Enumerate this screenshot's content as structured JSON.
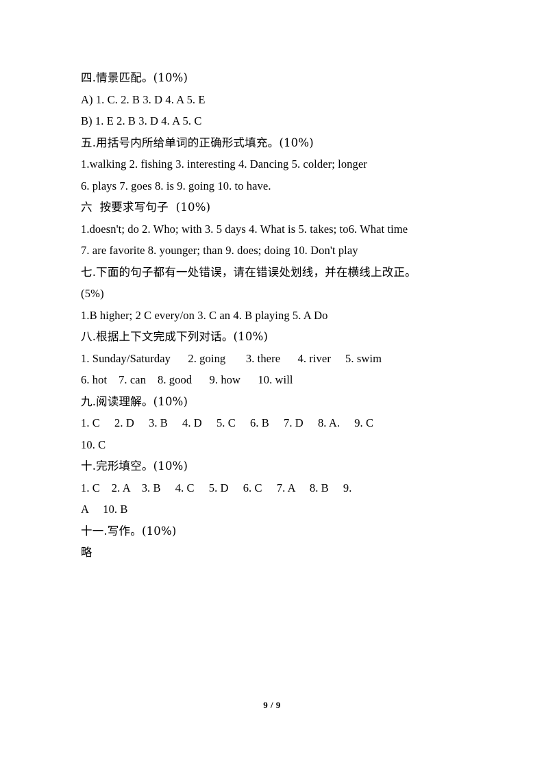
{
  "document": {
    "page_footer": "9 / 9",
    "sections": [
      {
        "id": "section-4",
        "heading": "四.情景匹配。(10%)",
        "lines": [
          "A) 1. C. 2. B 3. D 4. A 5. E",
          "B) 1. E 2. B 3. D 4. A 5. C"
        ]
      },
      {
        "id": "section-5",
        "heading": "五.用括号内所给单词的正确形式填充。(10%)",
        "lines": [
          "1.walking 2. fishing 3. interesting 4. Dancing 5. colder; longer",
          "6. plays 7. goes 8. is 9. going 10. to have."
        ]
      },
      {
        "id": "section-6",
        "heading": "六  按要求写句子  (10%)",
        "lines": [
          "1.doesn't; do 2. Who; with 3. 5 days 4. What is 5. takes; to6. What time",
          "7. are favorite 8. younger; than 9. does; doing 10. Don't play"
        ]
      },
      {
        "id": "section-7",
        "heading": "七.下面的句子都有一处错误，请在错误处划线，并在横线上改正。",
        "heading_cont": "(5%)",
        "lines": [
          "1.B higher; 2 C every/on 3. C an 4. B playing 5. A Do"
        ]
      },
      {
        "id": "section-8",
        "heading": "八.根据上下文完成下列对话。(10%)",
        "lines": [
          "1. Sunday/Saturday      2. going       3. there      4. river     5. swim",
          "6. hot    7. can    8. good      9. how      10. will"
        ]
      },
      {
        "id": "section-9",
        "heading": "九.阅读理解。(10%)",
        "lines": [
          "1. C     2. D     3. B     4. D     5. C     6. B     7. D     8. A.     9. C",
          "10. C"
        ]
      },
      {
        "id": "section-10",
        "heading": "十.完形填空。(10%)",
        "lines": [
          "1. C    2. A    3. B     4. C     5. D     6. C     7. A     8. B     9.",
          "A     10. B"
        ]
      },
      {
        "id": "section-11",
        "heading": "十一.写作。(10%)",
        "lines": [
          "略"
        ]
      }
    ]
  }
}
